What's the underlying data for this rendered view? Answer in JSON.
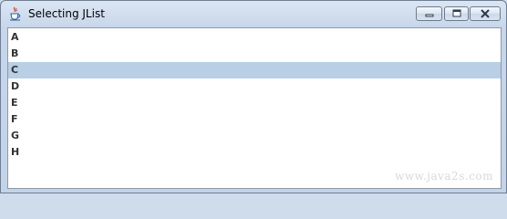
{
  "window": {
    "title": "Selecting JList",
    "icon": "java-cup-icon"
  },
  "caption_buttons": {
    "minimize_icon": "minimize-icon",
    "maximize_icon": "maximize-icon",
    "close_icon": "close-icon"
  },
  "list": {
    "items": [
      "A",
      "B",
      "C",
      "D",
      "E",
      "F",
      "G",
      "H"
    ],
    "selected": "C",
    "selection_color": "#b8cfe5"
  },
  "watermark": "www.java2s.com"
}
